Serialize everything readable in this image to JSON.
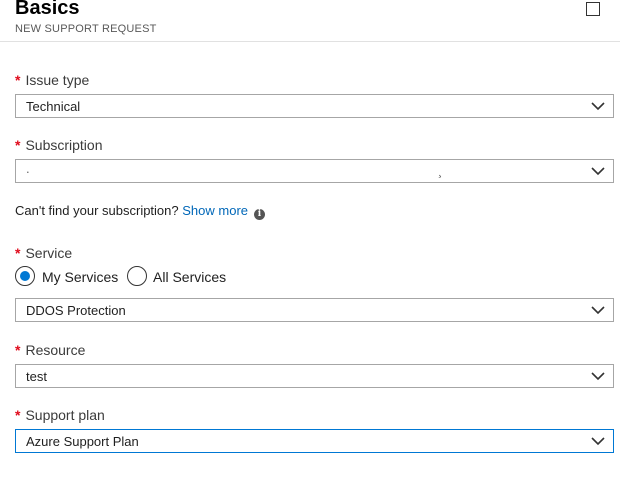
{
  "header": {
    "title": "Basics",
    "subtitle": "NEW SUPPORT REQUEST"
  },
  "form": {
    "required_marker": "*",
    "issue_type": {
      "label": "Issue type",
      "value": "Technical"
    },
    "subscription": {
      "label": "Subscription",
      "value": ".",
      "value_tail": "¸"
    },
    "subscription_help": {
      "text": "Can't find your subscription?",
      "link": "Show more",
      "icon": "info-icon"
    },
    "service": {
      "label": "Service",
      "options": [
        {
          "label": "My Services",
          "selected": true
        },
        {
          "label": "All Services",
          "selected": false
        }
      ],
      "value": "DDOS Protection"
    },
    "resource": {
      "label": "Resource",
      "value": "test"
    },
    "support_plan": {
      "label": "Support plan",
      "value": "Azure Support Plan"
    }
  },
  "colors": {
    "required": "#e00b1c",
    "link": "#0067b8",
    "accent": "#0078d4"
  }
}
